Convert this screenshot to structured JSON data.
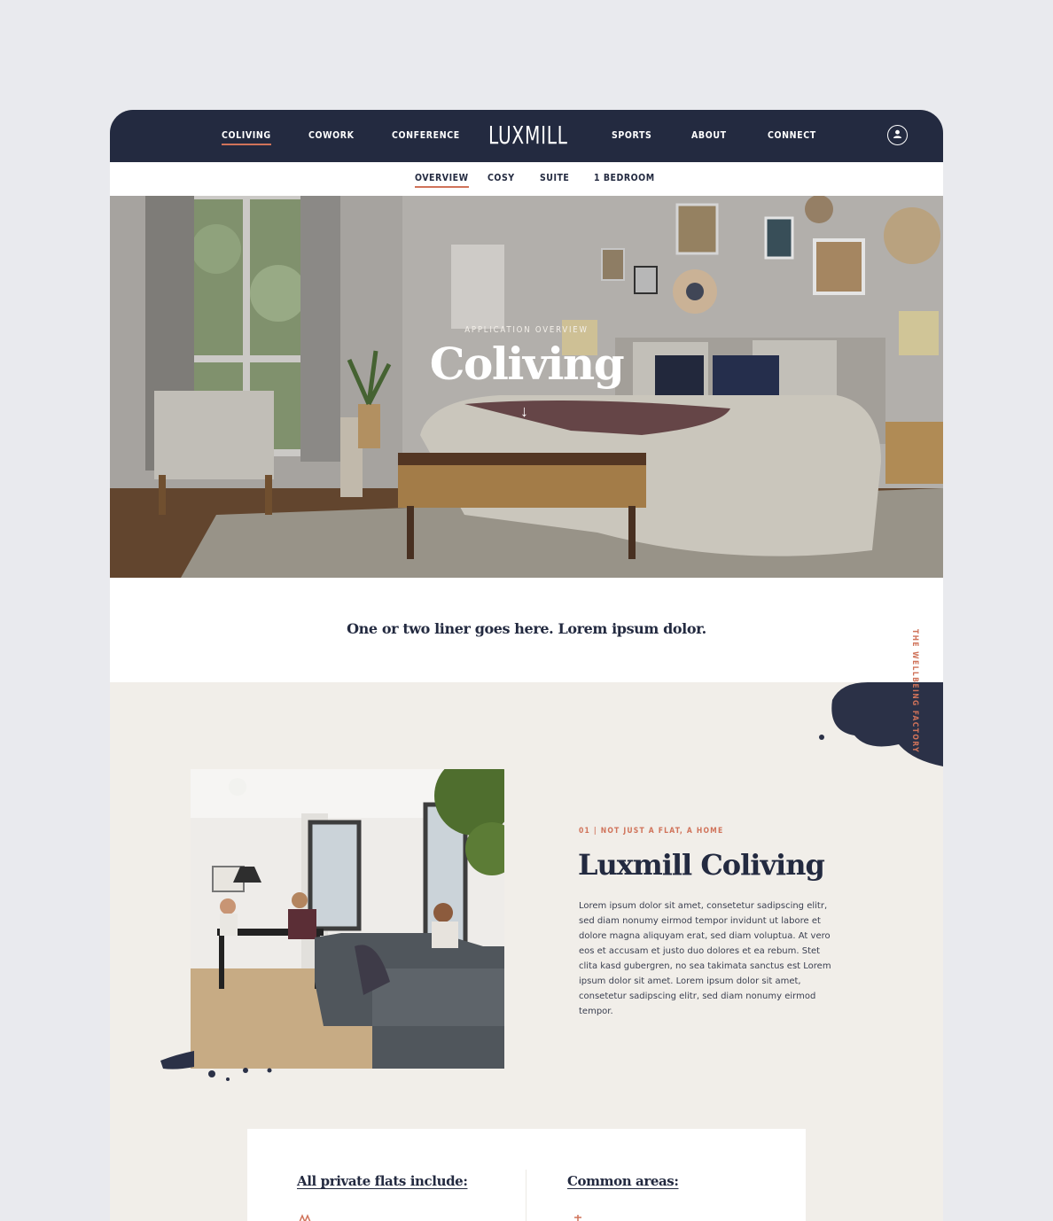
{
  "nav": {
    "left_items": [
      "COLIVING",
      "COWORK",
      "CONFERENCE"
    ],
    "logo": "LUXMILL",
    "right_items": [
      "SPORTS",
      "ABOUT",
      "CONNECT"
    ]
  },
  "subnav": {
    "items": [
      "OVERVIEW",
      "COSY",
      "SUITE",
      "1 BEDROOM"
    ]
  },
  "hero": {
    "eyebrow": "APPLICATION OVERVIEW",
    "title": "Coliving",
    "arrow": "↓"
  },
  "intro": {
    "text": "One or two liner goes here. Lorem ipsum dolor."
  },
  "side_tag": "THE WELLBEING FACTORY",
  "feature": {
    "eyebrow": "01 | NOT JUST A FLAT, A HOME",
    "title": "Luxmill Coliving",
    "body": "Lorem ipsum dolor sit amet, consetetur sadipscing elitr, sed diam nonumy eirmod tempor invidunt ut labore et dolore magna aliquyam erat, sed diam voluptua. At vero eos et accusam et justo duo dolores et ea rebum. Stet clita kasd gubergren, no sea takimata sanctus est Lorem ipsum dolor sit amet. Lorem ipsum dolor sit amet, consetetur sadipscing elitr, sed diam nonumy eirmod tempor."
  },
  "card": {
    "left_heading": "All private flats include:",
    "right_heading": "Common areas:"
  },
  "colors": {
    "navy": "#232a40",
    "accent": "#d0735a",
    "cream": "#f1eee9"
  }
}
